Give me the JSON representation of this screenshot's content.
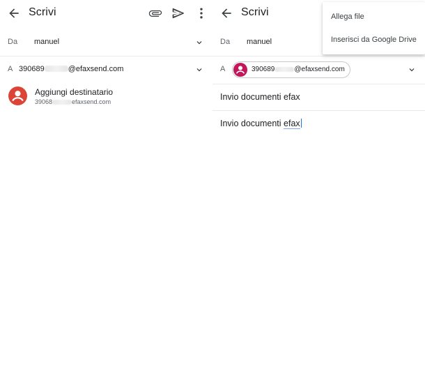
{
  "left": {
    "title": "Scrivi",
    "from_label": "Da",
    "from_value": "manuel",
    "to_label": "A",
    "to_prefix": "390689",
    "to_suffix": "@efaxsend.com",
    "suggestion": {
      "name": "Aggiungi destinatario",
      "email_prefix": "39068",
      "email_suffix": "efaxsend.com"
    },
    "icons": [
      "back-arrow-icon",
      "attach-icon",
      "send-icon",
      "more-vert-icon",
      "chevron-down-icon"
    ]
  },
  "right": {
    "title": "Scrivi",
    "from_label": "Da",
    "from_value": "manuel",
    "to_label": "A",
    "chip_prefix": "390689",
    "chip_suffix": "@efaxsend.com",
    "subject": "Invio documenti efax",
    "body_prefix": "Invio documenti ",
    "body_word": "efax",
    "menu": {
      "items": [
        "Allega file",
        "Inserisci da Google Drive"
      ]
    }
  },
  "colors": {
    "avatar_suggestion": "#db4437",
    "avatar_chip": "#c2185b",
    "caret": "#1a73e8"
  }
}
